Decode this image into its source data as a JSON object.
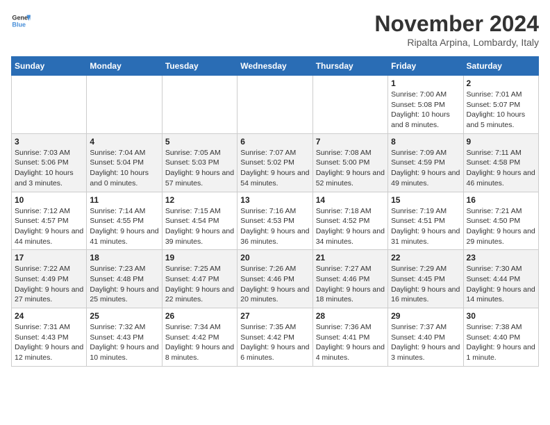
{
  "logo": {
    "line1": "General",
    "line2": "Blue"
  },
  "title": "November 2024",
  "location": "Ripalta Arpina, Lombardy, Italy",
  "days_of_week": [
    "Sunday",
    "Monday",
    "Tuesday",
    "Wednesday",
    "Thursday",
    "Friday",
    "Saturday"
  ],
  "weeks": [
    [
      {
        "day": "",
        "info": ""
      },
      {
        "day": "",
        "info": ""
      },
      {
        "day": "",
        "info": ""
      },
      {
        "day": "",
        "info": ""
      },
      {
        "day": "",
        "info": ""
      },
      {
        "day": "1",
        "info": "Sunrise: 7:00 AM\nSunset: 5:08 PM\nDaylight: 10 hours and 8 minutes."
      },
      {
        "day": "2",
        "info": "Sunrise: 7:01 AM\nSunset: 5:07 PM\nDaylight: 10 hours and 5 minutes."
      }
    ],
    [
      {
        "day": "3",
        "info": "Sunrise: 7:03 AM\nSunset: 5:06 PM\nDaylight: 10 hours and 3 minutes."
      },
      {
        "day": "4",
        "info": "Sunrise: 7:04 AM\nSunset: 5:04 PM\nDaylight: 10 hours and 0 minutes."
      },
      {
        "day": "5",
        "info": "Sunrise: 7:05 AM\nSunset: 5:03 PM\nDaylight: 9 hours and 57 minutes."
      },
      {
        "day": "6",
        "info": "Sunrise: 7:07 AM\nSunset: 5:02 PM\nDaylight: 9 hours and 54 minutes."
      },
      {
        "day": "7",
        "info": "Sunrise: 7:08 AM\nSunset: 5:00 PM\nDaylight: 9 hours and 52 minutes."
      },
      {
        "day": "8",
        "info": "Sunrise: 7:09 AM\nSunset: 4:59 PM\nDaylight: 9 hours and 49 minutes."
      },
      {
        "day": "9",
        "info": "Sunrise: 7:11 AM\nSunset: 4:58 PM\nDaylight: 9 hours and 46 minutes."
      }
    ],
    [
      {
        "day": "10",
        "info": "Sunrise: 7:12 AM\nSunset: 4:57 PM\nDaylight: 9 hours and 44 minutes."
      },
      {
        "day": "11",
        "info": "Sunrise: 7:14 AM\nSunset: 4:55 PM\nDaylight: 9 hours and 41 minutes."
      },
      {
        "day": "12",
        "info": "Sunrise: 7:15 AM\nSunset: 4:54 PM\nDaylight: 9 hours and 39 minutes."
      },
      {
        "day": "13",
        "info": "Sunrise: 7:16 AM\nSunset: 4:53 PM\nDaylight: 9 hours and 36 minutes."
      },
      {
        "day": "14",
        "info": "Sunrise: 7:18 AM\nSunset: 4:52 PM\nDaylight: 9 hours and 34 minutes."
      },
      {
        "day": "15",
        "info": "Sunrise: 7:19 AM\nSunset: 4:51 PM\nDaylight: 9 hours and 31 minutes."
      },
      {
        "day": "16",
        "info": "Sunrise: 7:21 AM\nSunset: 4:50 PM\nDaylight: 9 hours and 29 minutes."
      }
    ],
    [
      {
        "day": "17",
        "info": "Sunrise: 7:22 AM\nSunset: 4:49 PM\nDaylight: 9 hours and 27 minutes."
      },
      {
        "day": "18",
        "info": "Sunrise: 7:23 AM\nSunset: 4:48 PM\nDaylight: 9 hours and 25 minutes."
      },
      {
        "day": "19",
        "info": "Sunrise: 7:25 AM\nSunset: 4:47 PM\nDaylight: 9 hours and 22 minutes."
      },
      {
        "day": "20",
        "info": "Sunrise: 7:26 AM\nSunset: 4:46 PM\nDaylight: 9 hours and 20 minutes."
      },
      {
        "day": "21",
        "info": "Sunrise: 7:27 AM\nSunset: 4:46 PM\nDaylight: 9 hours and 18 minutes."
      },
      {
        "day": "22",
        "info": "Sunrise: 7:29 AM\nSunset: 4:45 PM\nDaylight: 9 hours and 16 minutes."
      },
      {
        "day": "23",
        "info": "Sunrise: 7:30 AM\nSunset: 4:44 PM\nDaylight: 9 hours and 14 minutes."
      }
    ],
    [
      {
        "day": "24",
        "info": "Sunrise: 7:31 AM\nSunset: 4:43 PM\nDaylight: 9 hours and 12 minutes."
      },
      {
        "day": "25",
        "info": "Sunrise: 7:32 AM\nSunset: 4:43 PM\nDaylight: 9 hours and 10 minutes."
      },
      {
        "day": "26",
        "info": "Sunrise: 7:34 AM\nSunset: 4:42 PM\nDaylight: 9 hours and 8 minutes."
      },
      {
        "day": "27",
        "info": "Sunrise: 7:35 AM\nSunset: 4:42 PM\nDaylight: 9 hours and 6 minutes."
      },
      {
        "day": "28",
        "info": "Sunrise: 7:36 AM\nSunset: 4:41 PM\nDaylight: 9 hours and 4 minutes."
      },
      {
        "day": "29",
        "info": "Sunrise: 7:37 AM\nSunset: 4:40 PM\nDaylight: 9 hours and 3 minutes."
      },
      {
        "day": "30",
        "info": "Sunrise: 7:38 AM\nSunset: 4:40 PM\nDaylight: 9 hours and 1 minute."
      }
    ]
  ]
}
